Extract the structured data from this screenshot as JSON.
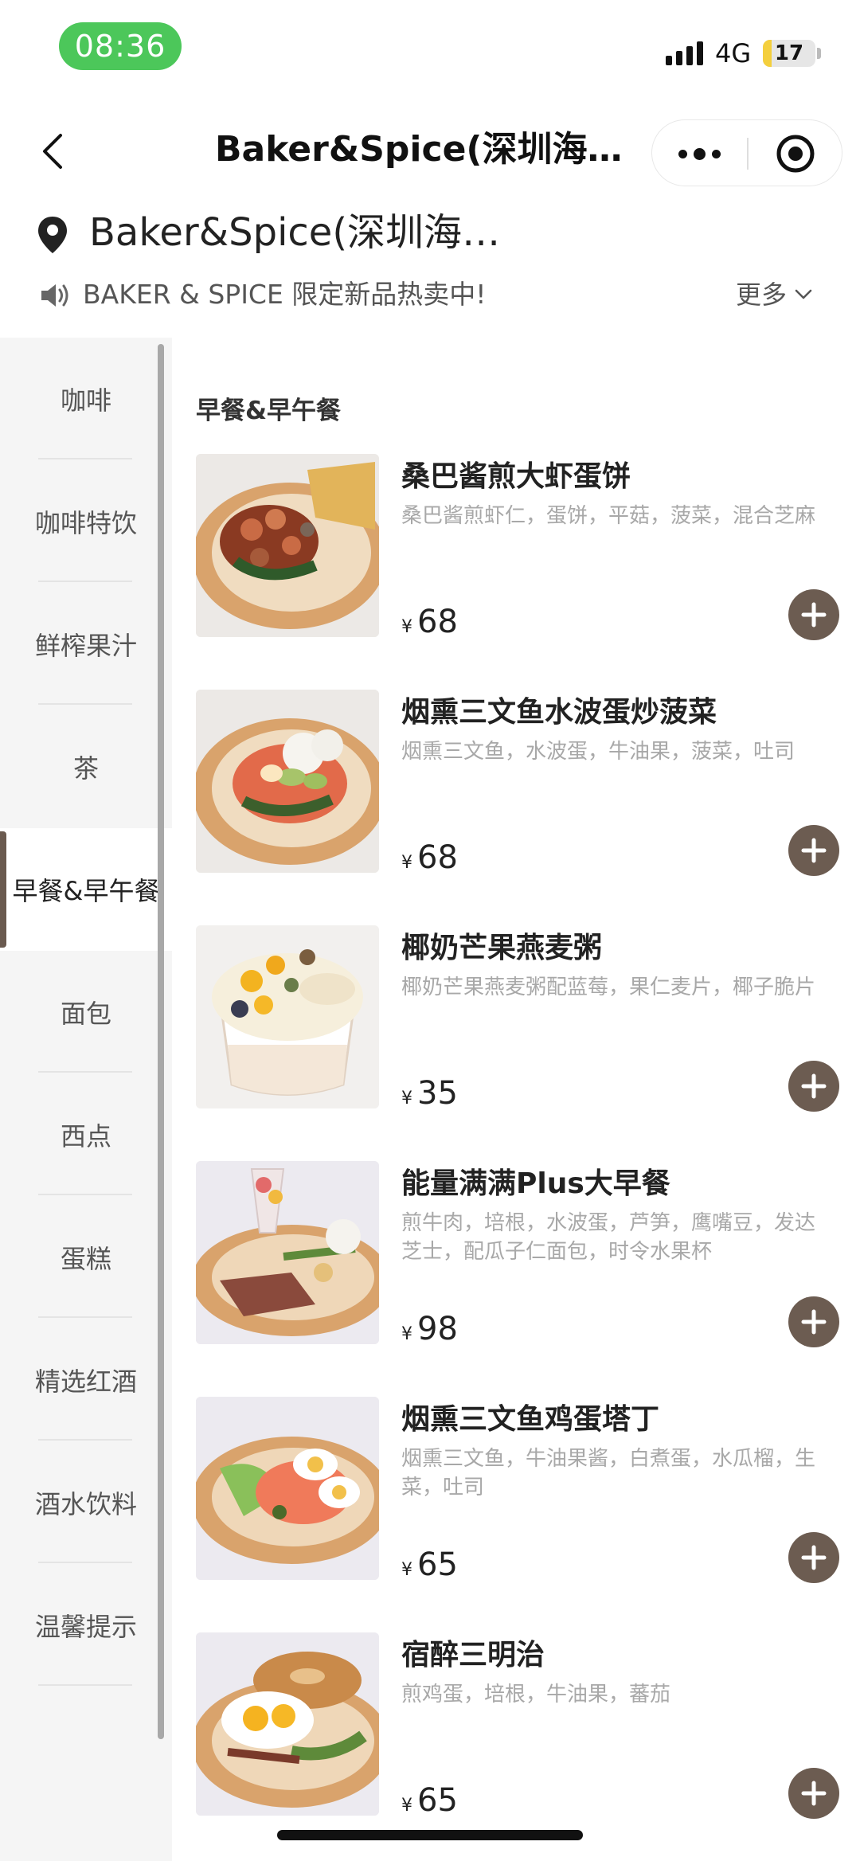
{
  "status_bar": {
    "time": "08:36",
    "network": "4G",
    "battery": "17",
    "battery_level": 0.17
  },
  "nav": {
    "title": "Baker&Spice(深圳海上世界店)",
    "icons": [
      "back-icon",
      "more-dots-icon",
      "target-icon"
    ]
  },
  "store": {
    "name": "Baker&Spice(深圳海上世界店)",
    "icon": "location-pin-icon"
  },
  "notice": {
    "text": "BAKER & SPICE 限定新品热卖中!",
    "more_label": "更多",
    "icon": "speaker-icon"
  },
  "categories": [
    {
      "label": "咖啡"
    },
    {
      "label": "咖啡特饮"
    },
    {
      "label": "鲜榨果汁"
    },
    {
      "label": "茶"
    },
    {
      "label": "早餐&早午餐",
      "active": true
    },
    {
      "label": "面包"
    },
    {
      "label": "西点"
    },
    {
      "label": "蛋糕"
    },
    {
      "label": "精选红酒"
    },
    {
      "label": "酒水饮料"
    },
    {
      "label": "温馨提示"
    }
  ],
  "section": {
    "title": "早餐&早午餐"
  },
  "items": [
    {
      "name": "桑巴酱煎大虾蛋饼",
      "desc": "桑巴酱煎虾仁，蛋饼，平菇，菠菜，混合芝麻",
      "currency": "¥",
      "price": "68"
    },
    {
      "name": "烟熏三文鱼水波蛋炒菠菜",
      "desc": "烟熏三文鱼，水波蛋，牛油果，菠菜，吐司",
      "currency": "¥",
      "price": "68"
    },
    {
      "name": "椰奶芒果燕麦粥",
      "desc": "椰奶芒果燕麦粥配蓝莓，果仁麦片，椰子脆片",
      "currency": "¥",
      "price": "35"
    },
    {
      "name": "能量满满Plus大早餐",
      "desc": "煎牛肉，培根，水波蛋，芦笋，鹰嘴豆，发达芝士，配瓜子仁面包，时令水果杯",
      "currency": "¥",
      "price": "98"
    },
    {
      "name": "烟熏三文鱼鸡蛋塔丁",
      "desc": "烟熏三文鱼，牛油果酱，白煮蛋，水瓜榴，生菜，吐司",
      "currency": "¥",
      "price": "65"
    },
    {
      "name": "宿醉三明治",
      "desc": "煎鸡蛋，培根，牛油果，蕃茄",
      "currency": "¥",
      "price": "65"
    }
  ],
  "colors": {
    "accent": "#6c5c51",
    "time_pill": "#4cc75a",
    "sidebar_bg": "#f5f5f5"
  }
}
